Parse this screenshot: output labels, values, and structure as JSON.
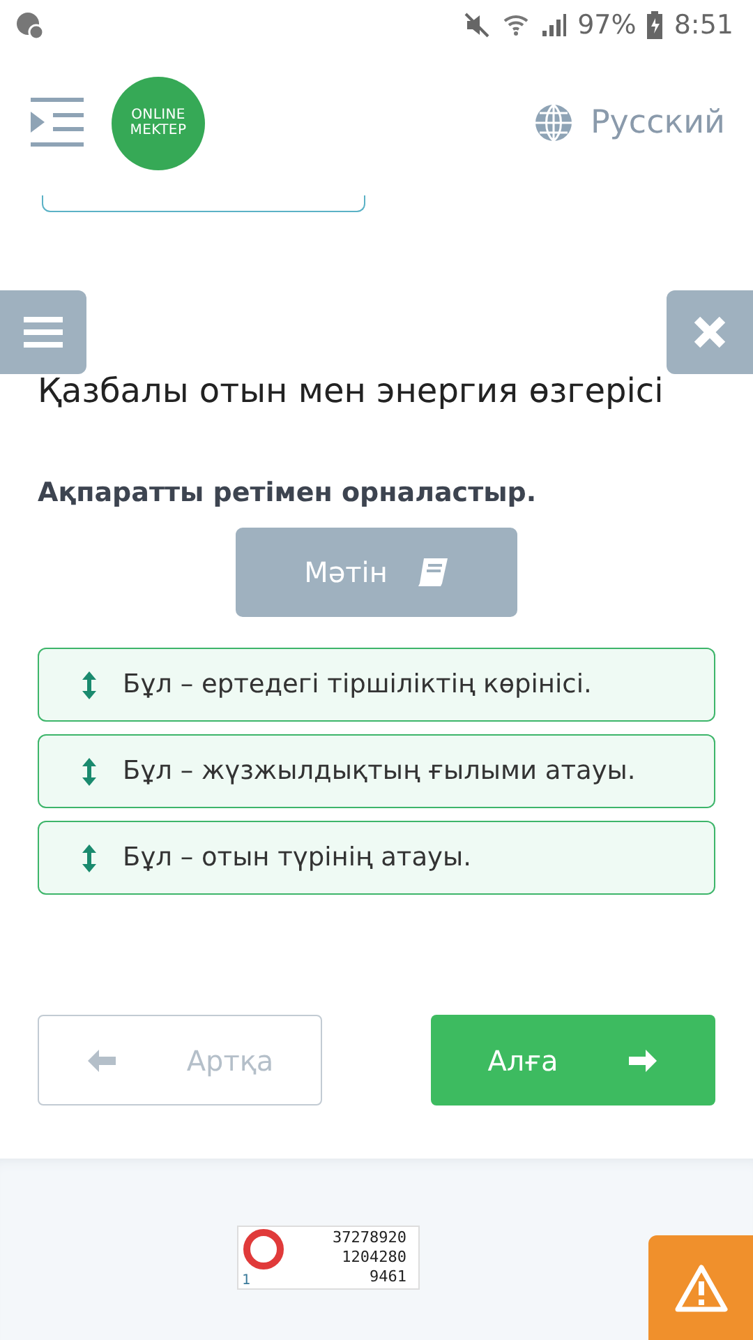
{
  "status_bar": {
    "battery": "97%",
    "time": "8:51"
  },
  "header": {
    "logo_lines": [
      "ONLINE",
      "MEKTEP"
    ],
    "language": "Русский"
  },
  "title": "Қазбалы отын мен энергия өзгерісі",
  "instruction": "Ақпаратты ретімен орналастыр.",
  "text_button": "Мәтін",
  "items": [
    {
      "text": "Бұл – ертедегі тіршіліктің көрінісі."
    },
    {
      "text": "Бұл – жүзжылдықтың ғылыми атауы."
    },
    {
      "text": "Бұл – отын түрінің атауы."
    }
  ],
  "nav": {
    "back": {
      "label": "Артқа",
      "disabled": true
    },
    "next": {
      "label": "Алға",
      "disabled": false
    }
  },
  "counter": {
    "total": "37278920",
    "today": "1204280",
    "online": "9461",
    "index": "1"
  }
}
